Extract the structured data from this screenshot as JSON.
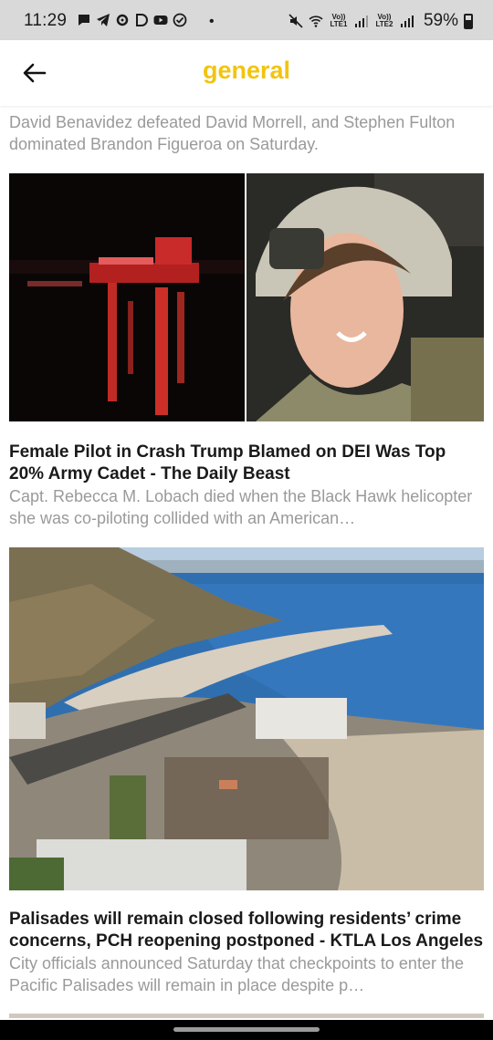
{
  "status_bar": {
    "time": "11:29",
    "left_icons": [
      "chat-icon",
      "telegram-icon",
      "settings-cog-icon",
      "app-d-icon",
      "youtube-icon",
      "check-circle-icon"
    ],
    "dot": "•",
    "signal1_label": "Vo)) LTE1",
    "signal2_label": "Vo)) LTE2",
    "battery": "59%"
  },
  "app_bar": {
    "title": "general",
    "title_color": "#f2c40f"
  },
  "articles": [
    {
      "headline": "",
      "summary": "David Benavidez defeated David Morrell, and Stephen Fulton dominated Brandon Figueroa on Saturday."
    },
    {
      "image": "split-photo-night-harbor-and-pilot",
      "headline": "Female Pilot in Crash Trump Blamed on DEI Was Top 20% Army Cadet - The Daily Beast",
      "summary": "Capt. Rebecca M. Lobach died when the Black Hawk helicopter she was co-piloting collided with an American…"
    },
    {
      "image": "aerial-photo-coastline-fire-damage",
      "headline": "Palisades will remain closed following residents’ crime concerns, PCH reopening postponed - KTLA Los Angeles",
      "summary": "City officials announced Saturday that checkpoints to enter the Pacific Palisades will remain in place despite p…"
    }
  ]
}
